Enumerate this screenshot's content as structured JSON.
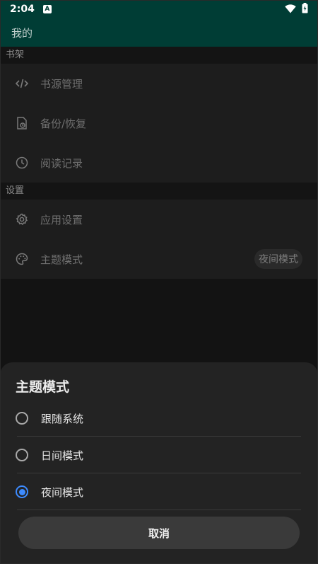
{
  "status_bar": {
    "time": "2:04",
    "notification_icon": "a-icon",
    "wifi_icon": "wifi-icon",
    "battery_icon": "battery-icon"
  },
  "app_bar": {
    "title": "我的"
  },
  "sections": [
    {
      "header": "书架",
      "items": [
        {
          "label": "书源管理",
          "icon": "code-icon"
        },
        {
          "label": "备份/恢复",
          "icon": "backup-icon"
        },
        {
          "label": "阅读记录",
          "icon": "clock-icon"
        }
      ]
    },
    {
      "header": "设置",
      "items": [
        {
          "label": "应用设置",
          "icon": "gear-icon"
        },
        {
          "label": "主题模式",
          "icon": "palette-icon",
          "badge": "夜间模式"
        }
      ]
    }
  ],
  "sheet": {
    "title": "主题模式",
    "options": [
      {
        "label": "跟随系统",
        "checked": false
      },
      {
        "label": "日间模式",
        "checked": false
      },
      {
        "label": "夜间模式",
        "checked": true
      }
    ],
    "cancel_label": "取消"
  },
  "colors": {
    "accent": "#3d8bff",
    "app_bar": "#003d35"
  }
}
